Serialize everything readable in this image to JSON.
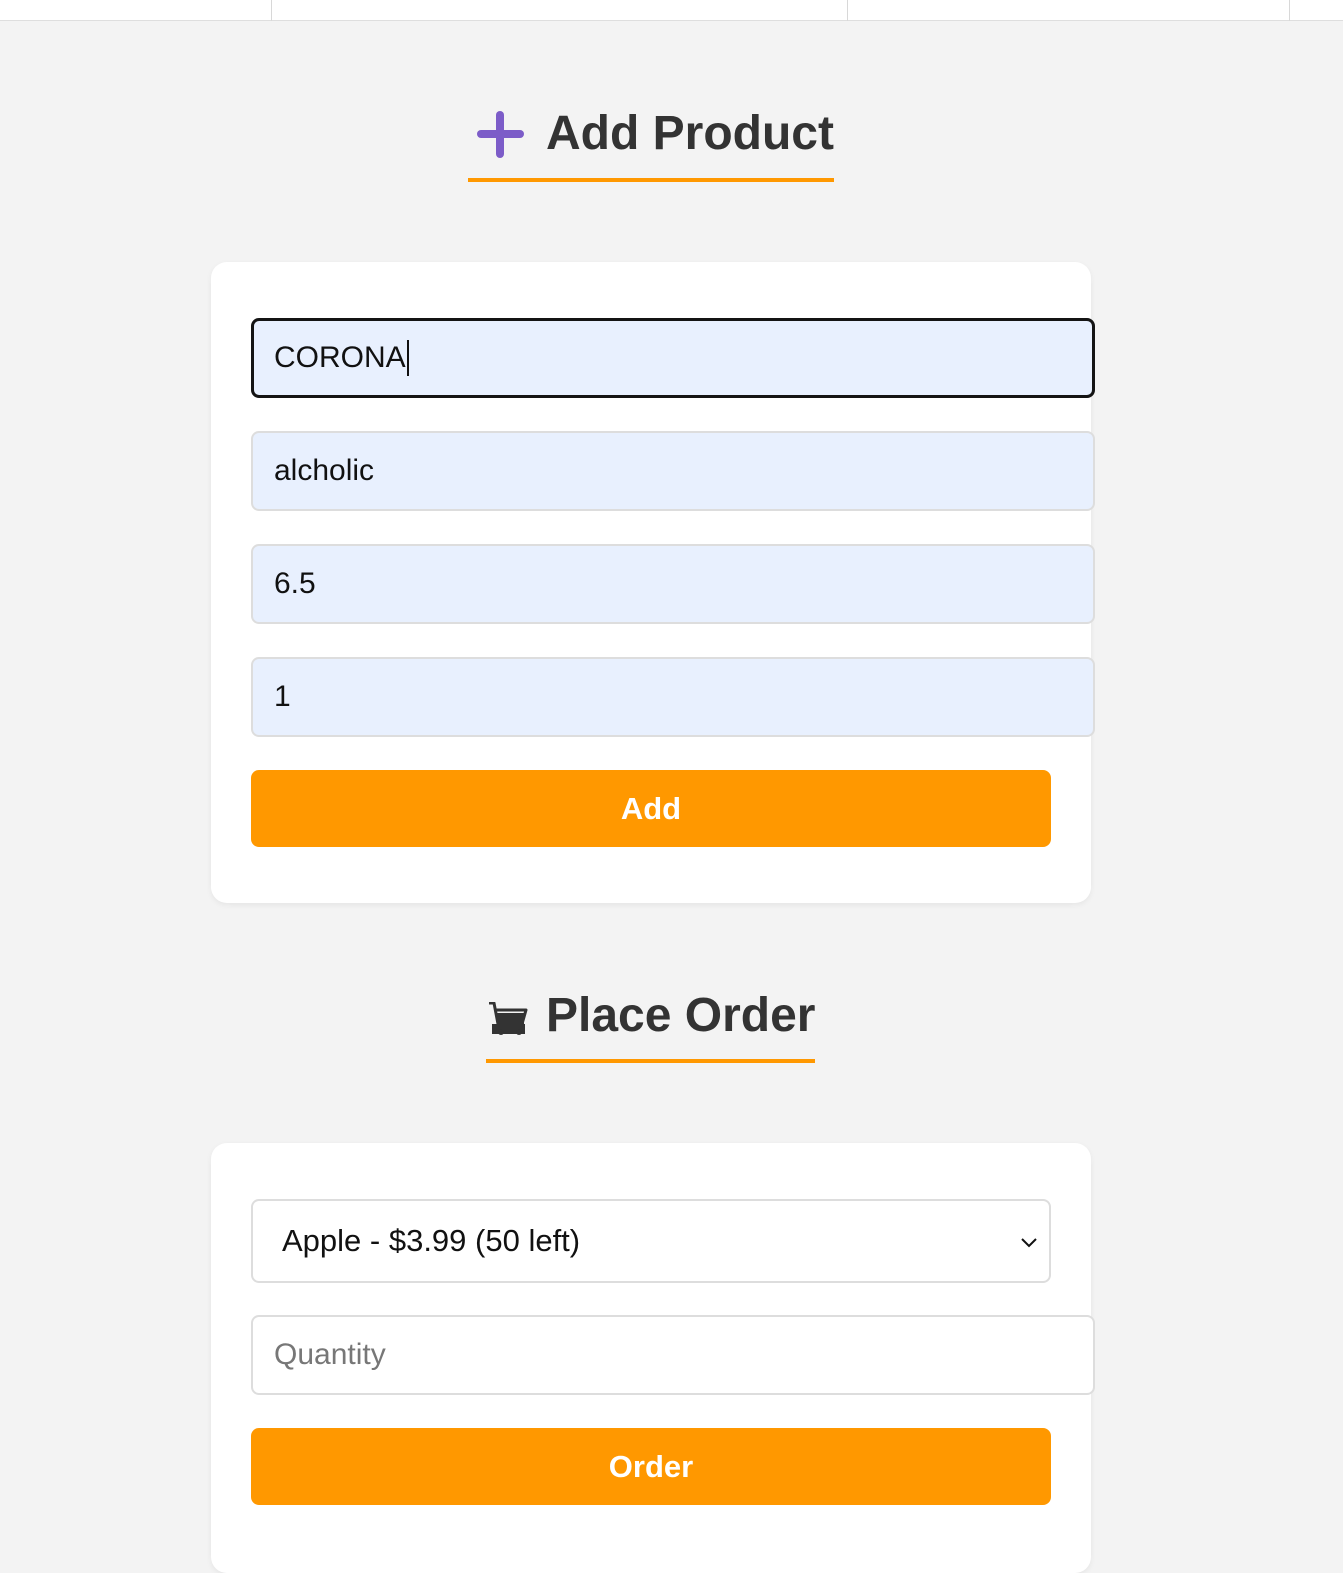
{
  "add_product": {
    "icon": "plus-icon",
    "icon_color": "#7c5cc8",
    "title": "Add Product",
    "fields": [
      {
        "value": "CORONA",
        "focused": true
      },
      {
        "value": "alcholic"
      },
      {
        "value": "6.5"
      },
      {
        "value": "1"
      }
    ],
    "submit_label": "Add"
  },
  "place_order": {
    "icon": "shopping-cart-icon",
    "title": "Place Order",
    "product_select": {
      "selected": "Apple - $3.99 (50 left)"
    },
    "quantity": {
      "value": "",
      "placeholder": "Quantity"
    },
    "submit_label": "Order"
  },
  "colors": {
    "accent": "#ff9800",
    "page_background": "#f3f3f3",
    "autofill_background": "#e8f0fe",
    "heading_text": "#333333"
  }
}
